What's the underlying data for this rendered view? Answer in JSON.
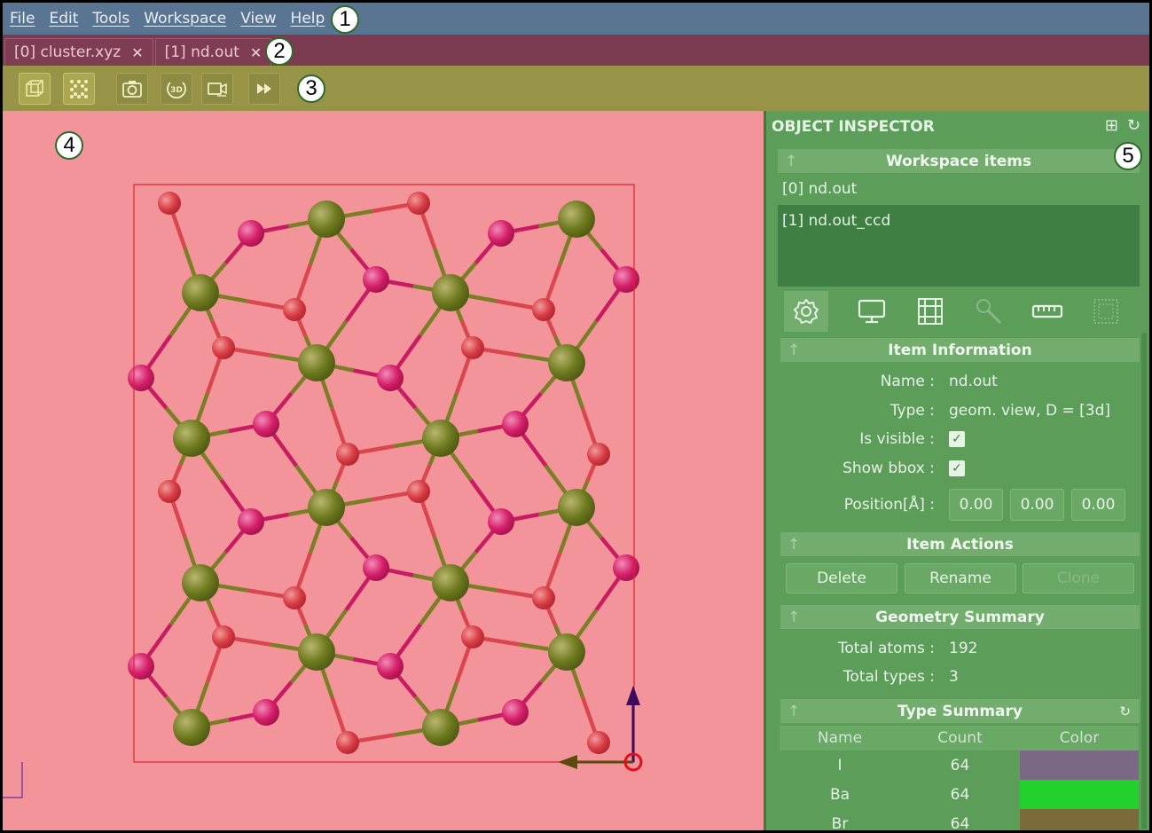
{
  "menu": {
    "items": [
      "File",
      "Edit",
      "Tools",
      "Workspace",
      "View",
      "Help"
    ]
  },
  "tabs": [
    {
      "label": "[0] cluster.xyz"
    },
    {
      "label": "[1] nd.out"
    }
  ],
  "toolbar": {
    "buttons": [
      "ortho-view-icon",
      "atoms-selection-icon",
      "screenshot-icon",
      "3d-rotate-icon",
      "record-video-icon",
      "fast-forward-icon"
    ]
  },
  "markers": [
    "1",
    "2",
    "3",
    "4",
    "5"
  ],
  "inspector": {
    "title": "OBJECT INSPECTOR",
    "workspace_items": {
      "header": "Workspace items",
      "items": [
        "[0] nd.out",
        "[1] nd.out_ccd"
      ]
    },
    "item_information": {
      "header": "Item Information",
      "name_label": "Name :",
      "name_value": "nd.out",
      "type_label": "Type :",
      "type_value": "geom. view, D = [3d]",
      "visible_label": "Is visible :",
      "bbox_label": "Show bbox :",
      "position_label": "Position[Å] :",
      "position": [
        "0.00",
        "0.00",
        "0.00"
      ]
    },
    "item_actions": {
      "header": "Item Actions",
      "delete": "Delete",
      "rename": "Rename",
      "clone": "Clone"
    },
    "geometry_summary": {
      "header": "Geometry Summary",
      "total_atoms_label": "Total atoms :",
      "total_atoms": "192",
      "total_types_label": "Total types :",
      "total_types": "3"
    },
    "type_summary": {
      "header": "Type Summary",
      "columns": [
        "Name",
        "Count",
        "Color"
      ],
      "rows": [
        {
          "name": "I",
          "count": "64",
          "color": "#7b6884"
        },
        {
          "name": "Ba",
          "count": "64",
          "color": "#22d12b"
        },
        {
          "name": "Br",
          "count": "64",
          "color": "#7b6b3a"
        }
      ]
    }
  }
}
